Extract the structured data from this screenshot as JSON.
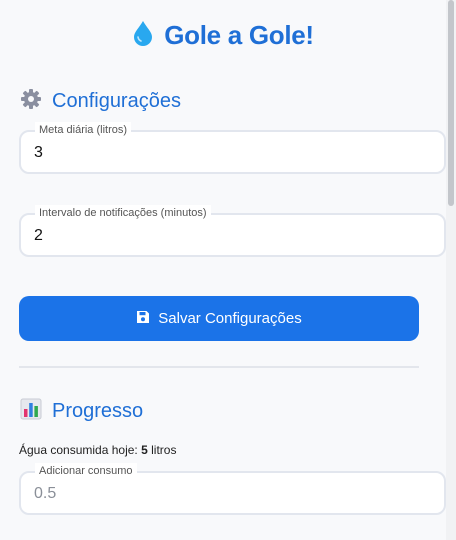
{
  "app": {
    "title": "Gole a Gole!"
  },
  "settings": {
    "heading": "Configurações",
    "daily_goal": {
      "label": "Meta diária (litros)",
      "value": "3"
    },
    "interval": {
      "label": "Intervalo de notificações (minutos)",
      "value": "2"
    },
    "save_label": "Salvar Configurações"
  },
  "progress": {
    "heading": "Progresso",
    "consumed_prefix": "Água consumida hoje: ",
    "consumed_amount": "5",
    "consumed_unit": " litros",
    "add_consumption": {
      "label": "Adicionar consumo",
      "placeholder": "0.5"
    }
  },
  "colors": {
    "accent": "#1f6fd6",
    "button": "#1b73e8",
    "water_drop": "#29a8ef"
  },
  "icons": {
    "title": "water-drop-icon",
    "settings": "gear-icon",
    "progress": "bar-chart-icon",
    "save": "floppy-disk-icon"
  }
}
